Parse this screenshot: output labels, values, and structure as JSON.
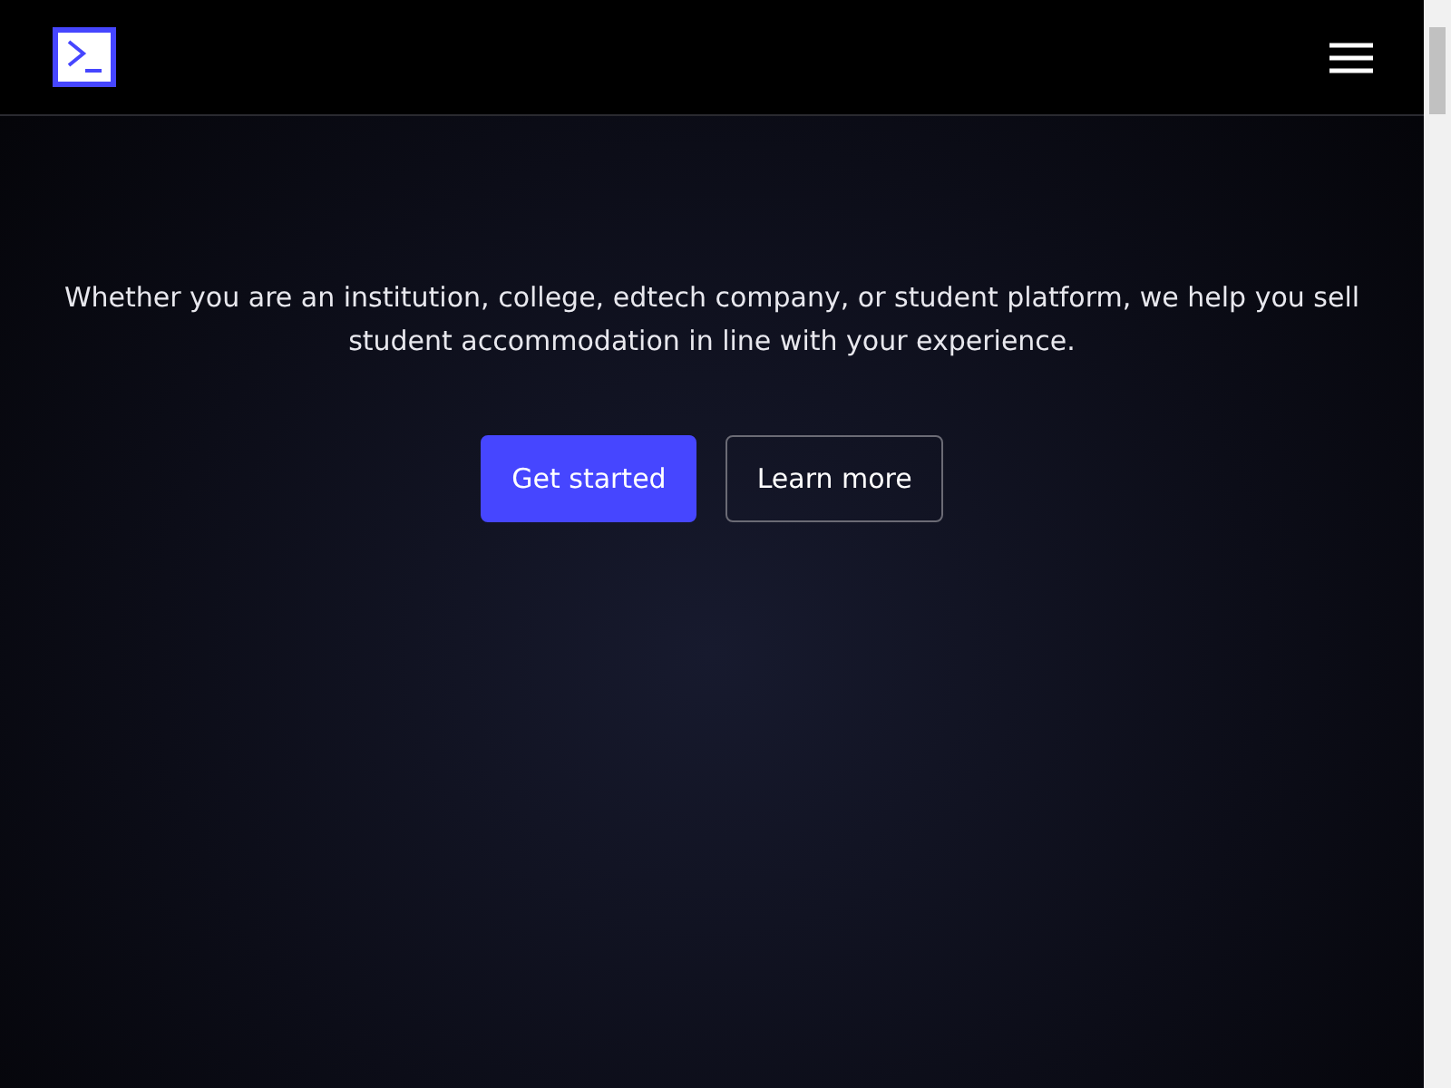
{
  "hero": {
    "text": "Whether you are an institution, college, edtech company, or student platform, we help you sell student accommodation in line with your experience.",
    "buttons": [
      {
        "label": "Get started",
        "kind": "primary"
      },
      {
        "label": "Learn more",
        "kind": "secondary"
      }
    ]
  }
}
